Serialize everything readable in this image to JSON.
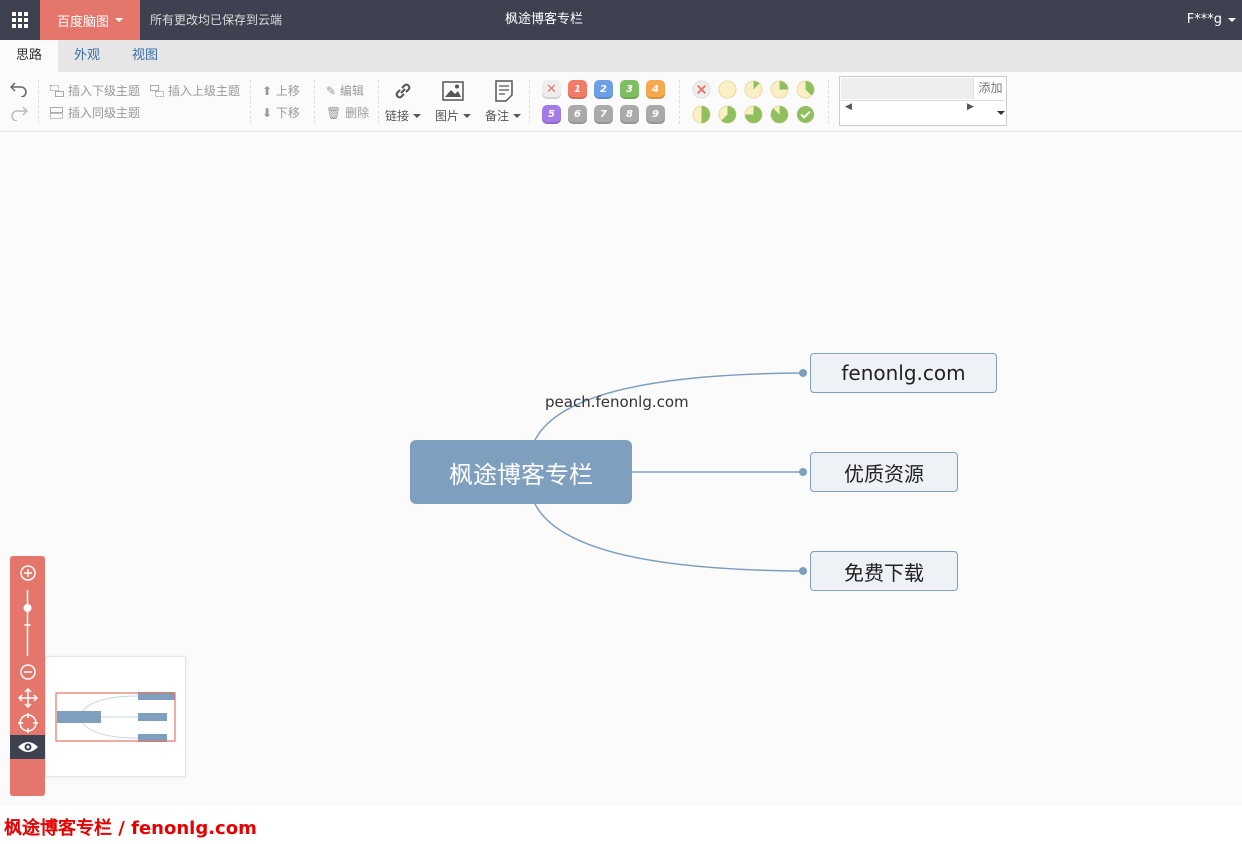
{
  "topbar": {
    "brand": "百度脑图",
    "save_status": "所有更改均已保存到云端",
    "title": "枫途博客专栏",
    "user": "F***g"
  },
  "tabs": [
    "思路",
    "外观",
    "视图"
  ],
  "toolbar": {
    "insert_child": "插入下级主题",
    "insert_parent": "插入上级主题",
    "insert_sibling": "插入同级主题",
    "move_up": "上移",
    "move_down": "下移",
    "edit": "编辑",
    "delete": "删除",
    "link": "链接",
    "image": "图片",
    "note": "备注",
    "priorities": [
      "1",
      "2",
      "3",
      "4",
      "5",
      "6",
      "7",
      "8",
      "9"
    ],
    "resource_add": "添加"
  },
  "mindmap": {
    "root": "枫途博客专栏",
    "relation_label": "peach.fenonlg.com",
    "children": [
      "fenonlg.com",
      "优质资源",
      "免费下载"
    ]
  },
  "footer": {
    "prefix": "枫途博客专栏 / ",
    "site": "fenonlg.com"
  },
  "colors": {
    "topbar": "#3d4150",
    "brand": "#e4766c",
    "node": "#7f9fbf",
    "watermark": "#e60000"
  }
}
